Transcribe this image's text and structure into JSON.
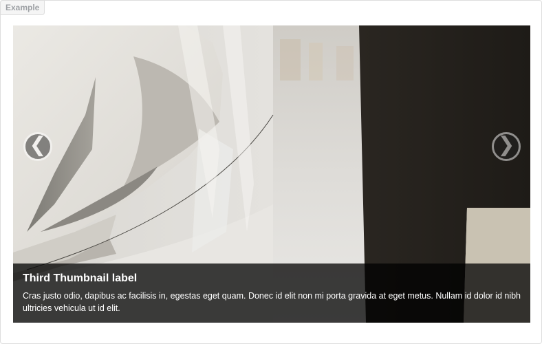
{
  "example": {
    "label": "Example"
  },
  "carousel": {
    "prev_glyph": "❮",
    "next_glyph": "❯",
    "caption": {
      "title": "Third Thumbnail label",
      "text": "Cras justo odio, dapibus ac facilisis in, egestas eget quam. Donec id elit non mi porta gravida at eget metus. Nullam id dolor id nibh ultricies vehicula ut id elit."
    }
  },
  "icons": {
    "prev": "chevron-left-icon",
    "next": "chevron-right-icon"
  },
  "colors": {
    "caption_background": "#000000",
    "caption_text": "#ffffff",
    "control_background": "#222222",
    "tag_text": "#9da0a4"
  }
}
